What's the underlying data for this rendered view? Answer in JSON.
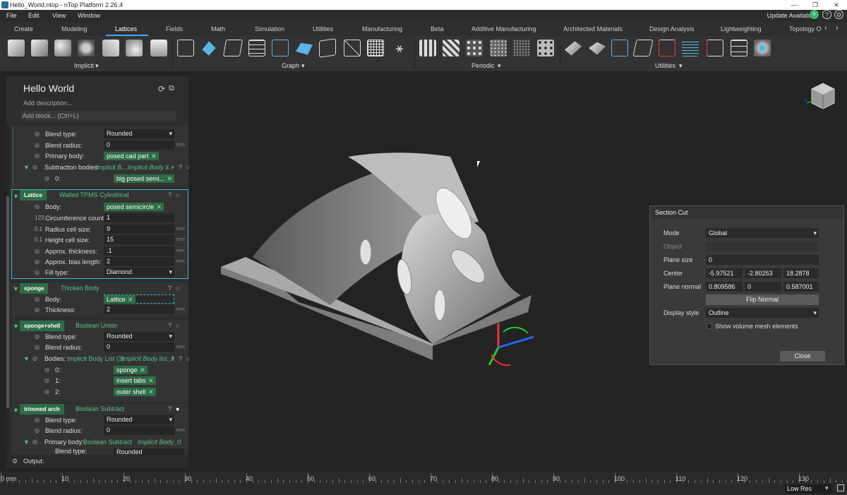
{
  "window": {
    "title": "Hello_World.ntop - nTop Platform 2.26.4",
    "controls": [
      "—",
      "❐",
      "✕"
    ]
  },
  "menu": {
    "items": [
      "File",
      "Edit",
      "View",
      "Window"
    ],
    "update": "Update Available"
  },
  "tabs": {
    "items": [
      "Create",
      "Modeling",
      "Lattices",
      "Fields",
      "Math",
      "Simulation",
      "Utilities",
      "Manufacturing",
      "Beta",
      "Additive Manufacturing",
      "Architected Materials",
      "Design Analysis",
      "Lightweighting",
      "Topology O"
    ],
    "active": "Lattices"
  },
  "ribbon": {
    "groups": [
      "Implicit",
      "Graph",
      "Periodic",
      "Utilities"
    ]
  },
  "panel": {
    "title": "Hello World",
    "description": "Add description...",
    "add_block": "Add block... (Ctrl+L)",
    "units": "mm",
    "b0": {
      "blend_type_label": "Blend type:",
      "blend_type": "Rounded",
      "blend_radius_label": "Blend radius:",
      "blend_radius": "0",
      "primary_body_label": "Primary body:",
      "primary_body": "posed cad part",
      "subtraction_label": "Subtraction bodies:",
      "subtraction_type": "Implicit B...",
      "subtraction_list": "Implicit Body li...",
      "item0_label": "0:",
      "item0": "big posed semi..."
    },
    "b1": {
      "name": "Lattice",
      "type": "Walled TPMS Cylindrical",
      "body_label": "Body:",
      "body": "posed semicircle",
      "circ_label": "Circumference count:",
      "circ": "1",
      "radius_label": "Radius cell size:",
      "radius": "9",
      "height_label": "Height cell size:",
      "height": "15",
      "thick_label": "Approx. thickness:",
      "thick": ".1",
      "bias_label": "Approx. bias length:",
      "bias": "2",
      "fill_label": "Fill type:",
      "fill": "Diamond"
    },
    "b2": {
      "name": "sponge",
      "type": "Thicken Body",
      "body_label": "Body:",
      "body": "Lattice",
      "thick_label": "Thickness:",
      "thick": "2"
    },
    "b3": {
      "name": "sponge+shell",
      "type": "Boolean Union",
      "blend_type_label": "Blend type:",
      "blend_type": "Rounded",
      "blend_radius_label": "Blend radius:",
      "blend_radius": "0",
      "bodies_label": "Bodies:",
      "bodies_type": "Implicit Body List (3)",
      "bodies_list": "Implicit Body list_3",
      "i0_label": "0:",
      "i0": "sponge",
      "i1_label": "1:",
      "i1": "insert tabs",
      "i2_label": "2:",
      "i2": "outer shell"
    },
    "b4": {
      "name": "trimmed arch",
      "type": "Boolean Subtract",
      "blend_type_label": "Blend type:",
      "blend_type": "Rounded",
      "blend_radius_label": "Blend radius:",
      "blend_radius": "0",
      "primary_label": "Primary body:",
      "primary_type": "Boolean Subtract",
      "primary_list": "Implicit Body_0",
      "cut_label": "Blend type:",
      "cut_val": "Rounded"
    },
    "output": "Output:"
  },
  "section_cut": {
    "title": "Section Cut",
    "mode_label": "Mode",
    "mode": "Global",
    "object_label": "Object",
    "plane_size_label": "Plane size",
    "plane_size": "0",
    "center_label": "Center",
    "center": [
      "-5.97521",
      "-2.80253",
      "18.2878"
    ],
    "normal_label": "Plane normal",
    "normal": [
      "0.809586",
      "0",
      "0.587001"
    ],
    "flip": "Flip Normal",
    "display_label": "Display style",
    "display": "Outline",
    "show_mesh": "Show volume mesh elements",
    "close": "Close"
  },
  "ruler": {
    "labels": [
      "0 mm",
      "10",
      "20",
      "30",
      "40",
      "50",
      "60",
      "70",
      "80",
      "90",
      "100",
      "110",
      "120",
      "130"
    ]
  },
  "status": {
    "resolution": "Low Res"
  }
}
